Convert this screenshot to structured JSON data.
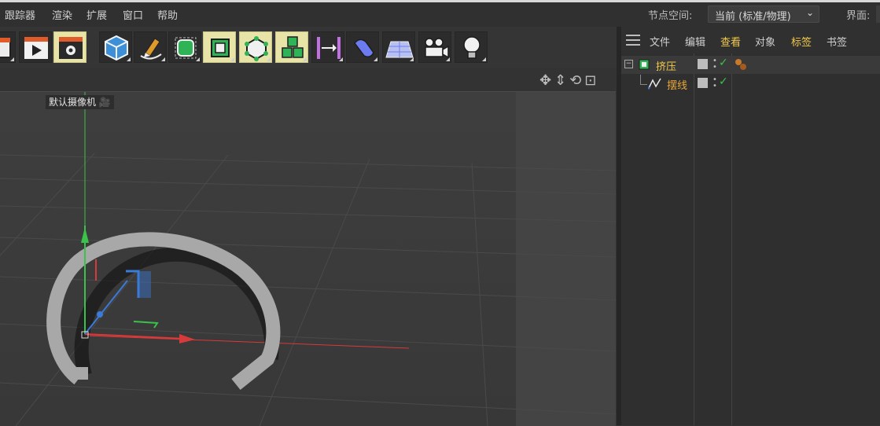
{
  "menubar": {
    "items": [
      "跟踪器",
      "渲染",
      "扩展",
      "窗口",
      "帮助"
    ],
    "node_space_label": "节点空间:",
    "node_space_value": "当前 (标准/物理)",
    "layout_label": "界面:"
  },
  "toolbar": {
    "tools": [
      {
        "icon": "clapper-icon"
      },
      {
        "icon": "render-view-icon"
      },
      {
        "icon": "render-settings-icon",
        "active": true
      },
      {
        "icon": "cube-icon"
      },
      {
        "icon": "pen-icon"
      },
      {
        "icon": "subdivision-icon"
      },
      {
        "icon": "extrude-icon",
        "active": true
      },
      {
        "icon": "cloner-icon",
        "active": true
      },
      {
        "icon": "array-icon",
        "active": true
      },
      {
        "icon": "symmetry-icon"
      },
      {
        "icon": "deformer-icon"
      },
      {
        "icon": "floor-icon"
      },
      {
        "icon": "camera-icon"
      },
      {
        "icon": "light-icon"
      }
    ]
  },
  "viewport": {
    "camera_label": "默认摄像机",
    "nav_icons": [
      "move-view-icon",
      "zoom-view-icon",
      "rotate-view-icon",
      "maximize-view-icon"
    ]
  },
  "object_manager": {
    "menu": [
      {
        "label": "文件",
        "highlight": false
      },
      {
        "label": "编辑",
        "highlight": false
      },
      {
        "label": "查看",
        "highlight": true
      },
      {
        "label": "对象",
        "highlight": false
      },
      {
        "label": "标签",
        "highlight": true
      },
      {
        "label": "书签",
        "highlight": false
      }
    ],
    "objects": [
      {
        "name": "挤压",
        "icon": "extrude-object-icon",
        "color": "#f2c94c",
        "has_material": true
      },
      {
        "name": "摆线",
        "icon": "spline-object-icon",
        "color": "#e8a83a",
        "has_material": false
      }
    ]
  },
  "colors": {
    "accent_yellow": "#f2c94c",
    "axis_x": "#d73a3a",
    "axis_y": "#3ac24a",
    "axis_z": "#3a7ad8",
    "active_tool": "#e8e4a8"
  }
}
